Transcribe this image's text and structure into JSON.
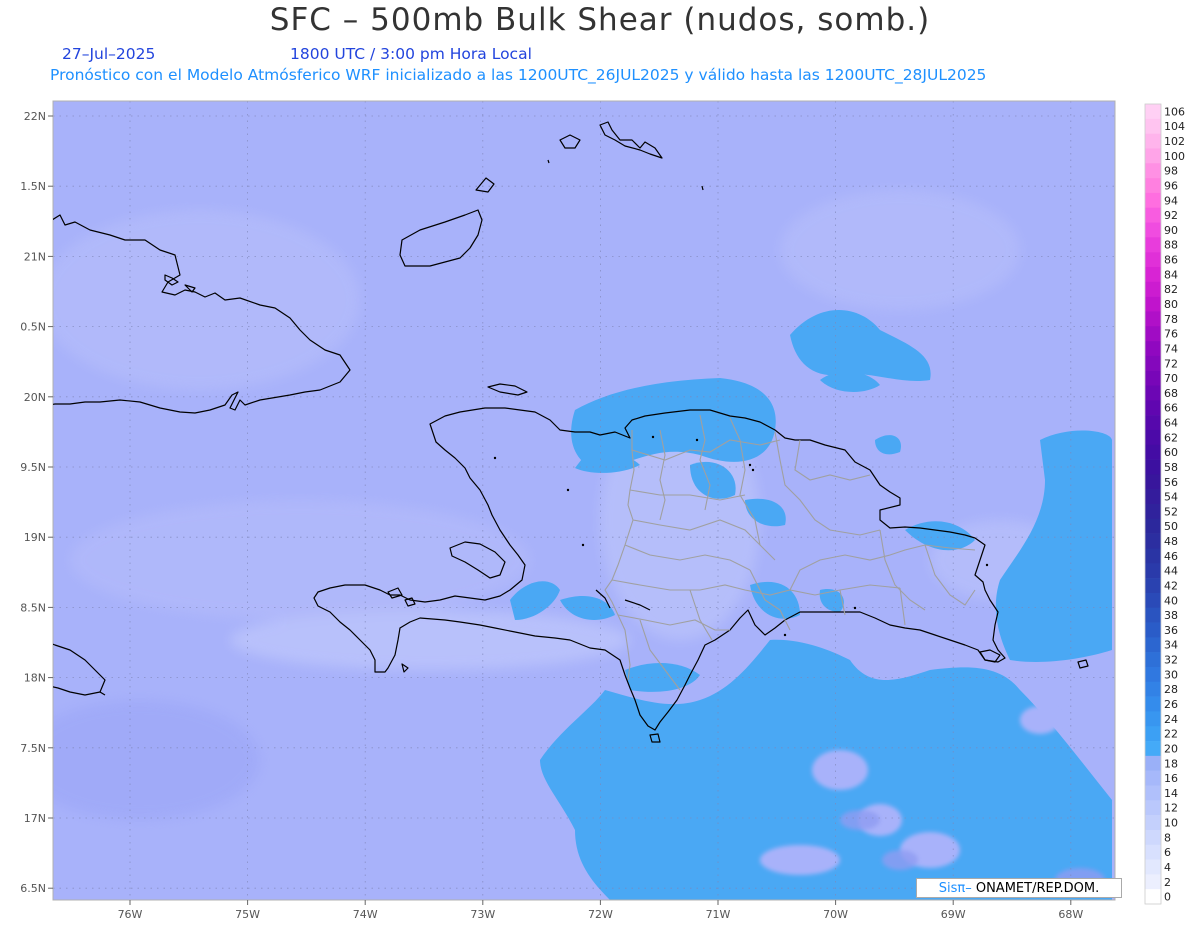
{
  "title": "SFC – 500mb Bulk Shear (nudos, somb.)",
  "subtitle": {
    "date": "27–Jul–2025",
    "time": "1800 UTC / 3:00 pm Hora Local",
    "validity": "Pronóstico con el Modelo Atmósferico WRF inicializado a las 1200UTC_26JUL2025 y válido hasta las  1200UTC_28JUL2025"
  },
  "lat_labels": [
    "22N",
    "1.5N",
    "21N",
    "0.5N",
    "20N",
    "9.5N",
    "19N",
    "8.5N",
    "18N",
    "7.5N",
    "17N",
    "6.5N"
  ],
  "lon_labels": [
    "76W",
    "75W",
    "74W",
    "73W",
    "72W",
    "71W",
    "70W",
    "69W",
    "68W"
  ],
  "colorbar": {
    "labels": [
      "106",
      "104",
      "102",
      "100",
      "98",
      "96",
      "94",
      "92",
      "90",
      "88",
      "86",
      "84",
      "82",
      "80",
      "78",
      "76",
      "74",
      "72",
      "70",
      "68",
      "66",
      "64",
      "62",
      "60",
      "58",
      "56",
      "54",
      "52",
      "50",
      "48",
      "46",
      "44",
      "42",
      "40",
      "38",
      "36",
      "34",
      "32",
      "30",
      "28",
      "26",
      "24",
      "22",
      "20",
      "18",
      "16",
      "14",
      "12",
      "10",
      "8",
      "6",
      "4",
      "2",
      "0"
    ],
    "colors": [
      "#ffd0f4",
      "#ffc4f0",
      "#ffb4ec",
      "#ffa4e8",
      "#ff90e4",
      "#ff80e0",
      "#ff6ee0",
      "#f85ce0",
      "#f04ce0",
      "#e83cdc",
      "#e030d8",
      "#d824d4",
      "#cc1cd0",
      "#c014cc",
      "#b010c8",
      "#a00cc4",
      "#9008c0",
      "#8408bc",
      "#7806b8",
      "#6c06b4",
      "#6006b0",
      "#5608ac",
      "#4c0aa8",
      "#440ca4",
      "#3c10a0",
      "#38169c",
      "#341c9c",
      "#30229c",
      "#2c289c",
      "#2c2ea0",
      "#2a34a4",
      "#2a3aaa",
      "#2a42b0",
      "#2a4ab8",
      "#2a54c0",
      "#2a5cc8",
      "#2c66d0",
      "#2e70d8",
      "#3078e0",
      "#3282e6",
      "#348cec",
      "#3896f0",
      "#3ca0f4",
      "#44aaf8",
      "#9ab0f8",
      "#a6b8fa",
      "#b0c0fb",
      "#bac8fc",
      "#c4d0fc",
      "#ced8fd",
      "#d8e0fe",
      "#e2e8fe",
      "#eceffe",
      "#ffffff"
    ]
  },
  "credit": {
    "sis": "Sisπ–",
    "org": " ONAMET/REP.DOM."
  },
  "colors": {
    "background": "#a6b0f9",
    "shade_20_22": "#4aa8f4",
    "coast": "#000000",
    "province_lines": "#a0a0a0"
  }
}
